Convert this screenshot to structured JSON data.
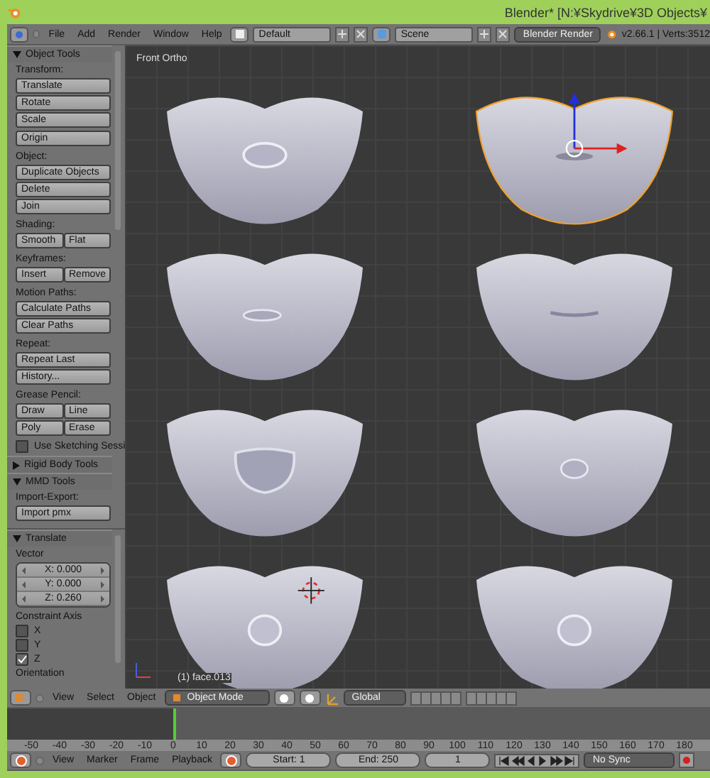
{
  "window": {
    "title": "Blender* [N:¥Skydrive¥3D Objects¥"
  },
  "menu_bar": {
    "menus": [
      "File",
      "Add",
      "Render",
      "Window",
      "Help"
    ],
    "layout": "Default",
    "scene": "Scene",
    "render_engine": "Blender Render",
    "stats": "v2.66.1 | Verts:3512"
  },
  "tool_panel": {
    "sections": [
      {
        "title": "Object Tools",
        "expanded": true,
        "items": [
          {
            "kind": "label",
            "text": "Transform:"
          },
          {
            "kind": "buttons",
            "rows": [
              [
                "Translate"
              ],
              [
                "Rotate"
              ],
              [
                "Scale"
              ]
            ]
          },
          {
            "kind": "buttons",
            "rows": [
              [
                "Origin"
              ]
            ]
          },
          {
            "kind": "label",
            "text": "Object:"
          },
          {
            "kind": "buttons",
            "rows": [
              [
                "Duplicate Objects"
              ],
              [
                "Delete"
              ],
              [
                "Join"
              ]
            ]
          },
          {
            "kind": "label",
            "text": "Shading:"
          },
          {
            "kind": "buttons",
            "rows": [
              [
                "Smooth",
                "Flat"
              ]
            ]
          },
          {
            "kind": "label",
            "text": "Keyframes:"
          },
          {
            "kind": "buttons",
            "rows": [
              [
                "Insert",
                "Remove"
              ]
            ]
          },
          {
            "kind": "label",
            "text": "Motion Paths:"
          },
          {
            "kind": "buttons",
            "rows": [
              [
                "Calculate Paths"
              ],
              [
                "Clear Paths"
              ]
            ]
          },
          {
            "kind": "label",
            "text": "Repeat:"
          },
          {
            "kind": "buttons",
            "rows": [
              [
                "Repeat Last"
              ],
              [
                "History..."
              ]
            ]
          },
          {
            "kind": "label",
            "text": "Grease Pencil:"
          },
          {
            "kind": "buttons",
            "rows": [
              [
                "Draw",
                "Line"
              ],
              [
                "Poly",
                "Erase"
              ]
            ]
          },
          {
            "kind": "checkbox",
            "text": "Use Sketching Sessi",
            "checked": false
          }
        ]
      },
      {
        "title": "Rigid Body Tools",
        "expanded": false
      },
      {
        "title": "MMD Tools",
        "expanded": true,
        "items": [
          {
            "kind": "label",
            "text": "Import-Export:"
          },
          {
            "kind": "buttons",
            "rows": [
              [
                "Import pmx"
              ]
            ]
          }
        ]
      }
    ]
  },
  "operator_panel": {
    "title": "Translate",
    "expanded": true,
    "vector_label": "Vector",
    "vector": [
      "X: 0.000",
      "Y: 0.000",
      "Z: 0.260"
    ],
    "constraint_label": "Constraint Axis",
    "axes": [
      {
        "label": "X",
        "checked": false
      },
      {
        "label": "Y",
        "checked": false
      },
      {
        "label": "Z",
        "checked": true
      }
    ],
    "orientation_label": "Orientation"
  },
  "viewport": {
    "view_label": "Front Ortho",
    "object_label": "(1) face.013",
    "models": [
      {
        "kind": "oval",
        "selected": false,
        "cursor": false
      },
      {
        "kind": "slit",
        "selected": true,
        "cursor": false
      },
      {
        "kind": "small-slit",
        "selected": false,
        "cursor": false
      },
      {
        "kind": "line",
        "selected": false,
        "cursor": false
      },
      {
        "kind": "wide",
        "selected": false,
        "cursor": false
      },
      {
        "kind": "small",
        "selected": false,
        "cursor": false
      },
      {
        "kind": "round",
        "selected": false,
        "cursor": true
      },
      {
        "kind": "round",
        "selected": false,
        "cursor": false
      }
    ]
  },
  "view_header": {
    "menus": [
      "View",
      "Select",
      "Object"
    ],
    "mode": "Object Mode",
    "orientation": "Global"
  },
  "timeline": {
    "ticks": [
      "-50",
      "-40",
      "-30",
      "-20",
      "-10",
      "0",
      "10",
      "20",
      "30",
      "40",
      "50",
      "60",
      "70",
      "80",
      "90",
      "100",
      "110",
      "120",
      "130",
      "140",
      "150",
      "160",
      "170",
      "180"
    ]
  },
  "timeline_header": {
    "menus": [
      "View",
      "Marker",
      "Frame",
      "Playback"
    ],
    "start": "Start: 1",
    "end": "End: 250",
    "frame": "1",
    "sync": "No Sync"
  }
}
